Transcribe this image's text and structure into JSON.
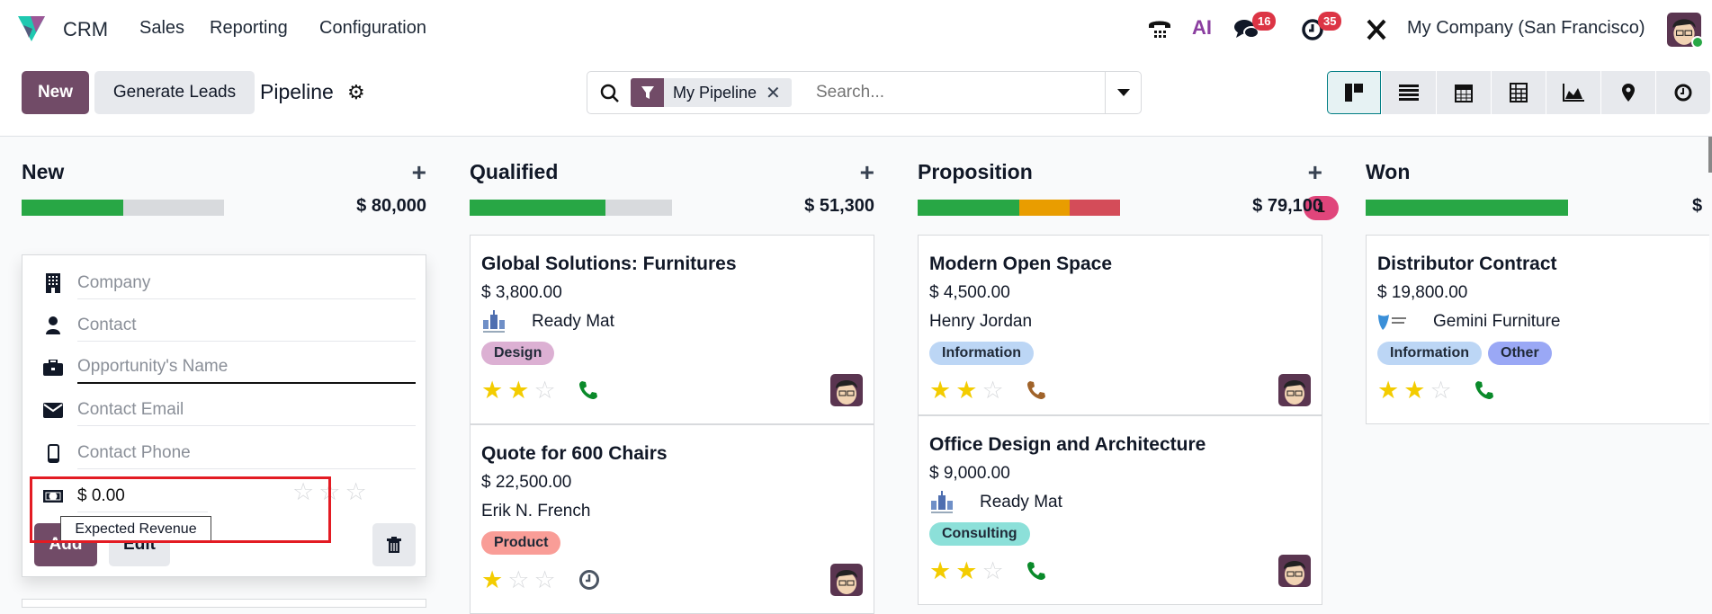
{
  "nav": {
    "app": "CRM",
    "menu": [
      "Sales",
      "Reporting",
      "Configuration"
    ],
    "company": "My Company (San Francisco)",
    "messages_badge": "16",
    "activities_badge": "35",
    "ai_label": "AI"
  },
  "control": {
    "new_label": "New",
    "generate_label": "Generate Leads",
    "title": "Pipeline",
    "facet": "My Pipeline",
    "search_placeholder": "Search..."
  },
  "views": [
    "kanban",
    "list",
    "calendar",
    "pivot",
    "graph",
    "map",
    "activity"
  ],
  "quick_create": {
    "company_placeholder": "Company",
    "contact_placeholder": "Contact",
    "name_placeholder": "Opportunity's Name",
    "email_placeholder": "Contact Email",
    "phone_placeholder": "Contact Phone",
    "revenue_value": "$ 0.00",
    "tooltip": "Expected Revenue",
    "add_label": "Add",
    "edit_label": "Edit",
    "priority": 0
  },
  "columns": [
    {
      "title": "New",
      "total": "$ 80,000",
      "progress": [
        {
          "pct": 50,
          "color": "#28a745"
        }
      ],
      "cards": []
    },
    {
      "title": "Qualified",
      "total": "$ 51,300",
      "progress": [
        {
          "pct": 67,
          "color": "#28a745"
        }
      ],
      "cards": [
        {
          "title": "Global Solutions: Furnitures",
          "amount": "$ 3,800.00",
          "partner": "Ready Mat",
          "logo": "readymat",
          "tags": [
            {
              "label": "Design",
              "color": "#dcb0d3"
            }
          ],
          "stars": 2,
          "activity": "phone-green"
        },
        {
          "title": "Quote for 600 Chairs",
          "amount": "$ 22,500.00",
          "partner": "Erik N. French",
          "logo": "",
          "tags": [
            {
              "label": "Product",
              "color": "#f99d97"
            }
          ],
          "stars": 1,
          "activity": "clock"
        }
      ]
    },
    {
      "title": "Proposition",
      "total": "$ 79,100",
      "count": "1",
      "progress": [
        {
          "pct": 50,
          "color": "#28a745"
        },
        {
          "pct": 25,
          "color": "#e99d00"
        },
        {
          "pct": 25,
          "color": "#d44c59"
        }
      ],
      "cards": [
        {
          "title": "Modern Open Space",
          "amount": "$ 4,500.00",
          "partner": "Henry Jordan",
          "logo": "",
          "tags": [
            {
              "label": "Information",
              "color": "#bcd6f5"
            }
          ],
          "stars": 2,
          "activity": "phone-orange"
        },
        {
          "title": "Office Design and Architecture",
          "amount": "$ 9,000.00",
          "partner": "Ready Mat",
          "logo": "readymat",
          "tags": [
            {
              "label": "Consulting",
              "color": "#8ce0d9"
            }
          ],
          "stars": 2,
          "activity": "phone-green"
        }
      ]
    },
    {
      "title": "Won",
      "total": "$",
      "progress": [
        {
          "pct": 100,
          "color": "#28a745"
        }
      ],
      "cards": [
        {
          "title": "Distributor Contract",
          "amount": "$ 19,800.00",
          "partner": "Gemini Furniture",
          "logo": "gemini",
          "tags": [
            {
              "label": "Information",
              "color": "#bcd6f5"
            },
            {
              "label": "Other",
              "color": "#9aa8f5"
            }
          ],
          "stars": 2,
          "activity": "phone-green"
        }
      ]
    }
  ]
}
